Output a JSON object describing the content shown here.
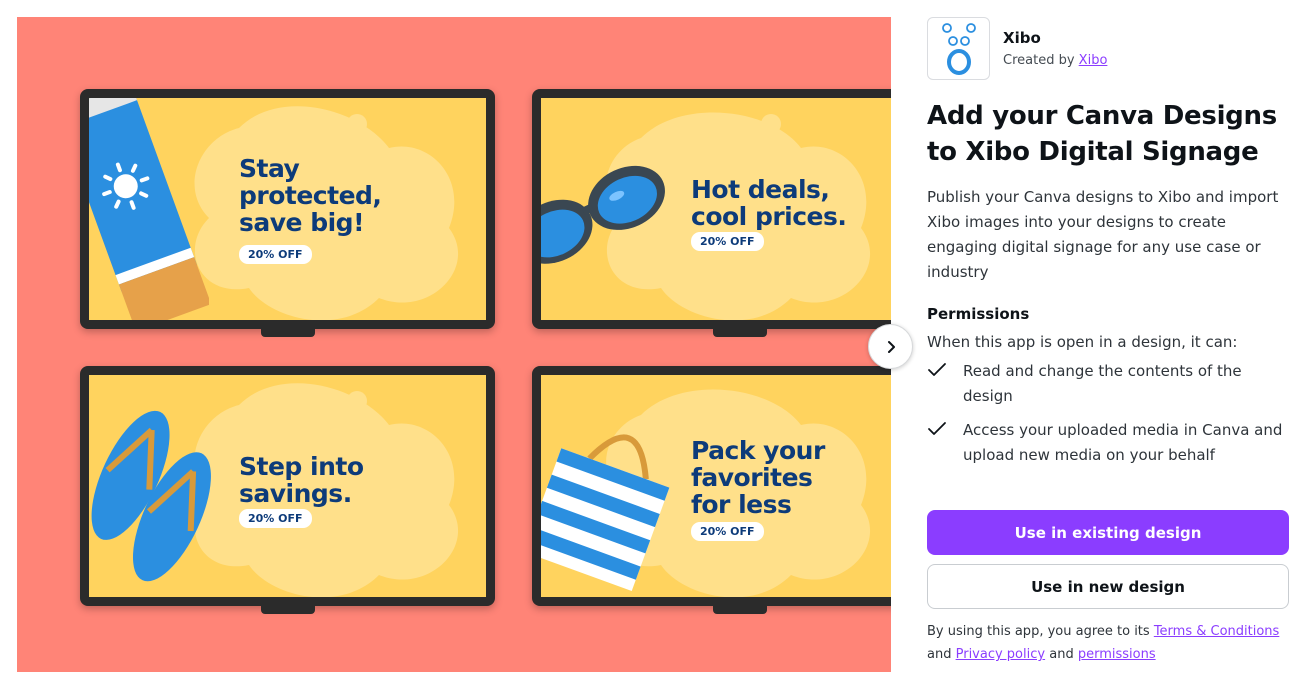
{
  "hero": {
    "screens": [
      {
        "headline": "Stay\nprotected,\nsave big!",
        "badge": "20% OFF"
      },
      {
        "headline": "Hot deals,\ncool prices.",
        "badge": "20% OFF"
      },
      {
        "headline": "Step into\nsavings.",
        "badge": "20% OFF"
      },
      {
        "headline": "Pack your\nfavorites\nfor less",
        "badge": "20% OFF"
      }
    ],
    "next_icon": "chevron-right-icon"
  },
  "app": {
    "name": "Xibo",
    "created_by_prefix": "Created by",
    "creator": "Xibo",
    "logo_icon": "xibo-logo"
  },
  "title": "Add your Canva Designs to Xibo Digital Signage",
  "description": "Publish your Canva designs to Xibo and import Xibo images into your designs to create engaging digital signage for any use case or industry",
  "permissions": {
    "heading": "Permissions",
    "intro": "When this app is open in a design, it can:",
    "items": [
      "Read and change the contents of the design",
      "Access your uploaded media in Canva and upload new media on your behalf"
    ]
  },
  "buttons": {
    "existing": "Use in existing design",
    "new": "Use in new design"
  },
  "terms": {
    "prefix": "By using this app, you agree to its",
    "terms_link": "Terms & Conditions",
    "and1": "and",
    "privacy_link": "Privacy policy",
    "and2": "and",
    "permissions_link": "permissions"
  },
  "colors": {
    "accent": "#8b3dff",
    "hero_bg": "#ff8477",
    "screen_bg": "#ffd35e",
    "headline": "#0d3b7a"
  }
}
